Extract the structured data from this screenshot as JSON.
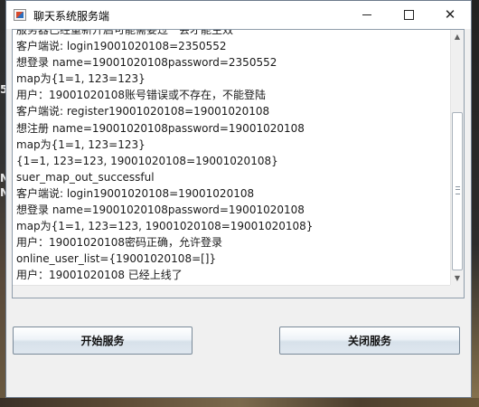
{
  "background": {
    "left_glyphs": [
      "5",
      "N",
      "N"
    ]
  },
  "window": {
    "title": "聊天系统服务端",
    "controls": {
      "minimize": "—",
      "maximize": "☐",
      "close": "✕"
    }
  },
  "log": {
    "lines": [
      "服务器已经重新开启可能需要过一会才能生效",
      "客户端说: login19001020108=2350552",
      "想登录 name=19001020108password=2350552",
      "map为{1=1, 123=123}",
      "用户：19001020108账号错误或不存在，不能登陆",
      "客户端说: register19001020108=19001020108",
      "想注册 name=19001020108password=19001020108",
      "map为{1=1, 123=123}",
      "{1=1, 123=123, 19001020108=19001020108}",
      "suer_map_out_successful",
      "客户端说: login19001020108=19001020108",
      "想登录 name=19001020108password=19001020108",
      "map为{1=1, 123=123, 19001020108=19001020108}",
      "用户：19001020108密码正确，允许登录",
      "online_user_list={19001020108=[]}",
      "用户：19001020108 已经上线了"
    ]
  },
  "buttons": {
    "start": "开始服务",
    "stop": "关闭服务"
  }
}
